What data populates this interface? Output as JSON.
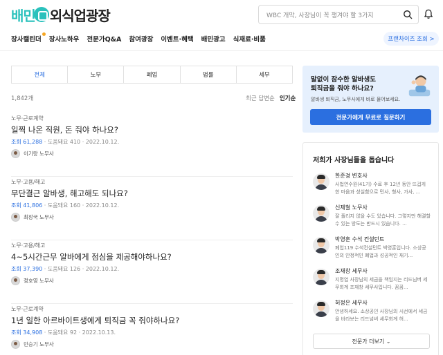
{
  "header": {
    "logo_brand": "배민",
    "logo_text": "외식업광장",
    "search_placeholder": "WBC 개막, 사장님이 꼭 챙겨야 할 3가지"
  },
  "nav": {
    "items": [
      "장사캘린더",
      "장사노하우",
      "전문가Q&A",
      "참여광장",
      "이벤트·혜택",
      "배민광고",
      "식재료·비품"
    ],
    "franchise_label": "프랜차이즈 조회 >"
  },
  "tabs": [
    "전체",
    "노무",
    "폐업",
    "법률",
    "세무"
  ],
  "list": {
    "count": "1,842개",
    "sort_recent": "최근 답변순",
    "sort_popular": "인기순"
  },
  "posts": [
    {
      "category": "노무·근로계약",
      "title": "일찍 나온 직원, 돈 줘야 하나요?",
      "views": "조회 61,288",
      "meta_rest": " · 도움돼요 410 · 2022.10.12.",
      "author": "이기랑 노무사"
    },
    {
      "category": "노무·고용/해고",
      "title": "무단결근 알바생, 해고해도 되나요?",
      "views": "조회 41,806",
      "meta_rest": " · 도움돼요 160 · 2022.10.12.",
      "author": "최장국 노무사"
    },
    {
      "category": "노무·고용/해고",
      "title": "4~5시간근무 알바에게 점심을 제공해야하나요?",
      "views": "조회 37,390",
      "meta_rest": " · 도움돼요 126 · 2022.10.12.",
      "author": "정호영 노무사"
    },
    {
      "category": "노무·근로계약",
      "title": "1년 일한 아르바이트생에게 퇴직금 꼭 줘야하나요?",
      "views": "조회 34,908",
      "meta_rest": " · 도움돼요 92 · 2022.10.13.",
      "author": "민승기 노무사"
    }
  ],
  "banner": {
    "line1": "말없이 잠수한 알바생도",
    "line2": "퇴직금을 줘야 하나요?",
    "sub": "알바생 퇴직금, 노무사에게 바로 물어보세요.",
    "button": "전문가에게 무료로 질문하기"
  },
  "experts": {
    "title": "저희가 사장님들을 돕습니다",
    "items": [
      {
        "name": "한준경 변호사",
        "desc": "사법연수원(41기) 수료 후 12년 동안 뜨겁게 한 마음과 성실함으로 민사, 형사, 가사, ..."
      },
      {
        "name": "신제철 노무사",
        "desc": "잘 풀리지 않을 수도 있습니다. 그렇지만 해결할 수 있는 방도는 반드시 있습니다. ..."
      },
      {
        "name": "박영훈 수석 컨설턴트",
        "desc": "폐업119 수석컨설턴트 박영훈입니다. 소상공인의 안정적인 폐업과 성공적인 재기..."
      },
      {
        "name": "조재창 세무사",
        "desc": "지명업 사장님의 세금을 책임지는 리드님버 세무회계 조재창 세무사입니다. 꼼꼼..."
      },
      {
        "name": "허정은 세무사",
        "desc": "안녕하세요. 소상공인 사장님의 시선에서 세금을 바라보는 리드넘버 세무회계 허..."
      }
    ],
    "more_button": "전문가 더보기 ⌄"
  },
  "colors": {
    "brand": "#2ac1bc",
    "accent": "#2b6fe0",
    "dot": "#f5a623"
  }
}
